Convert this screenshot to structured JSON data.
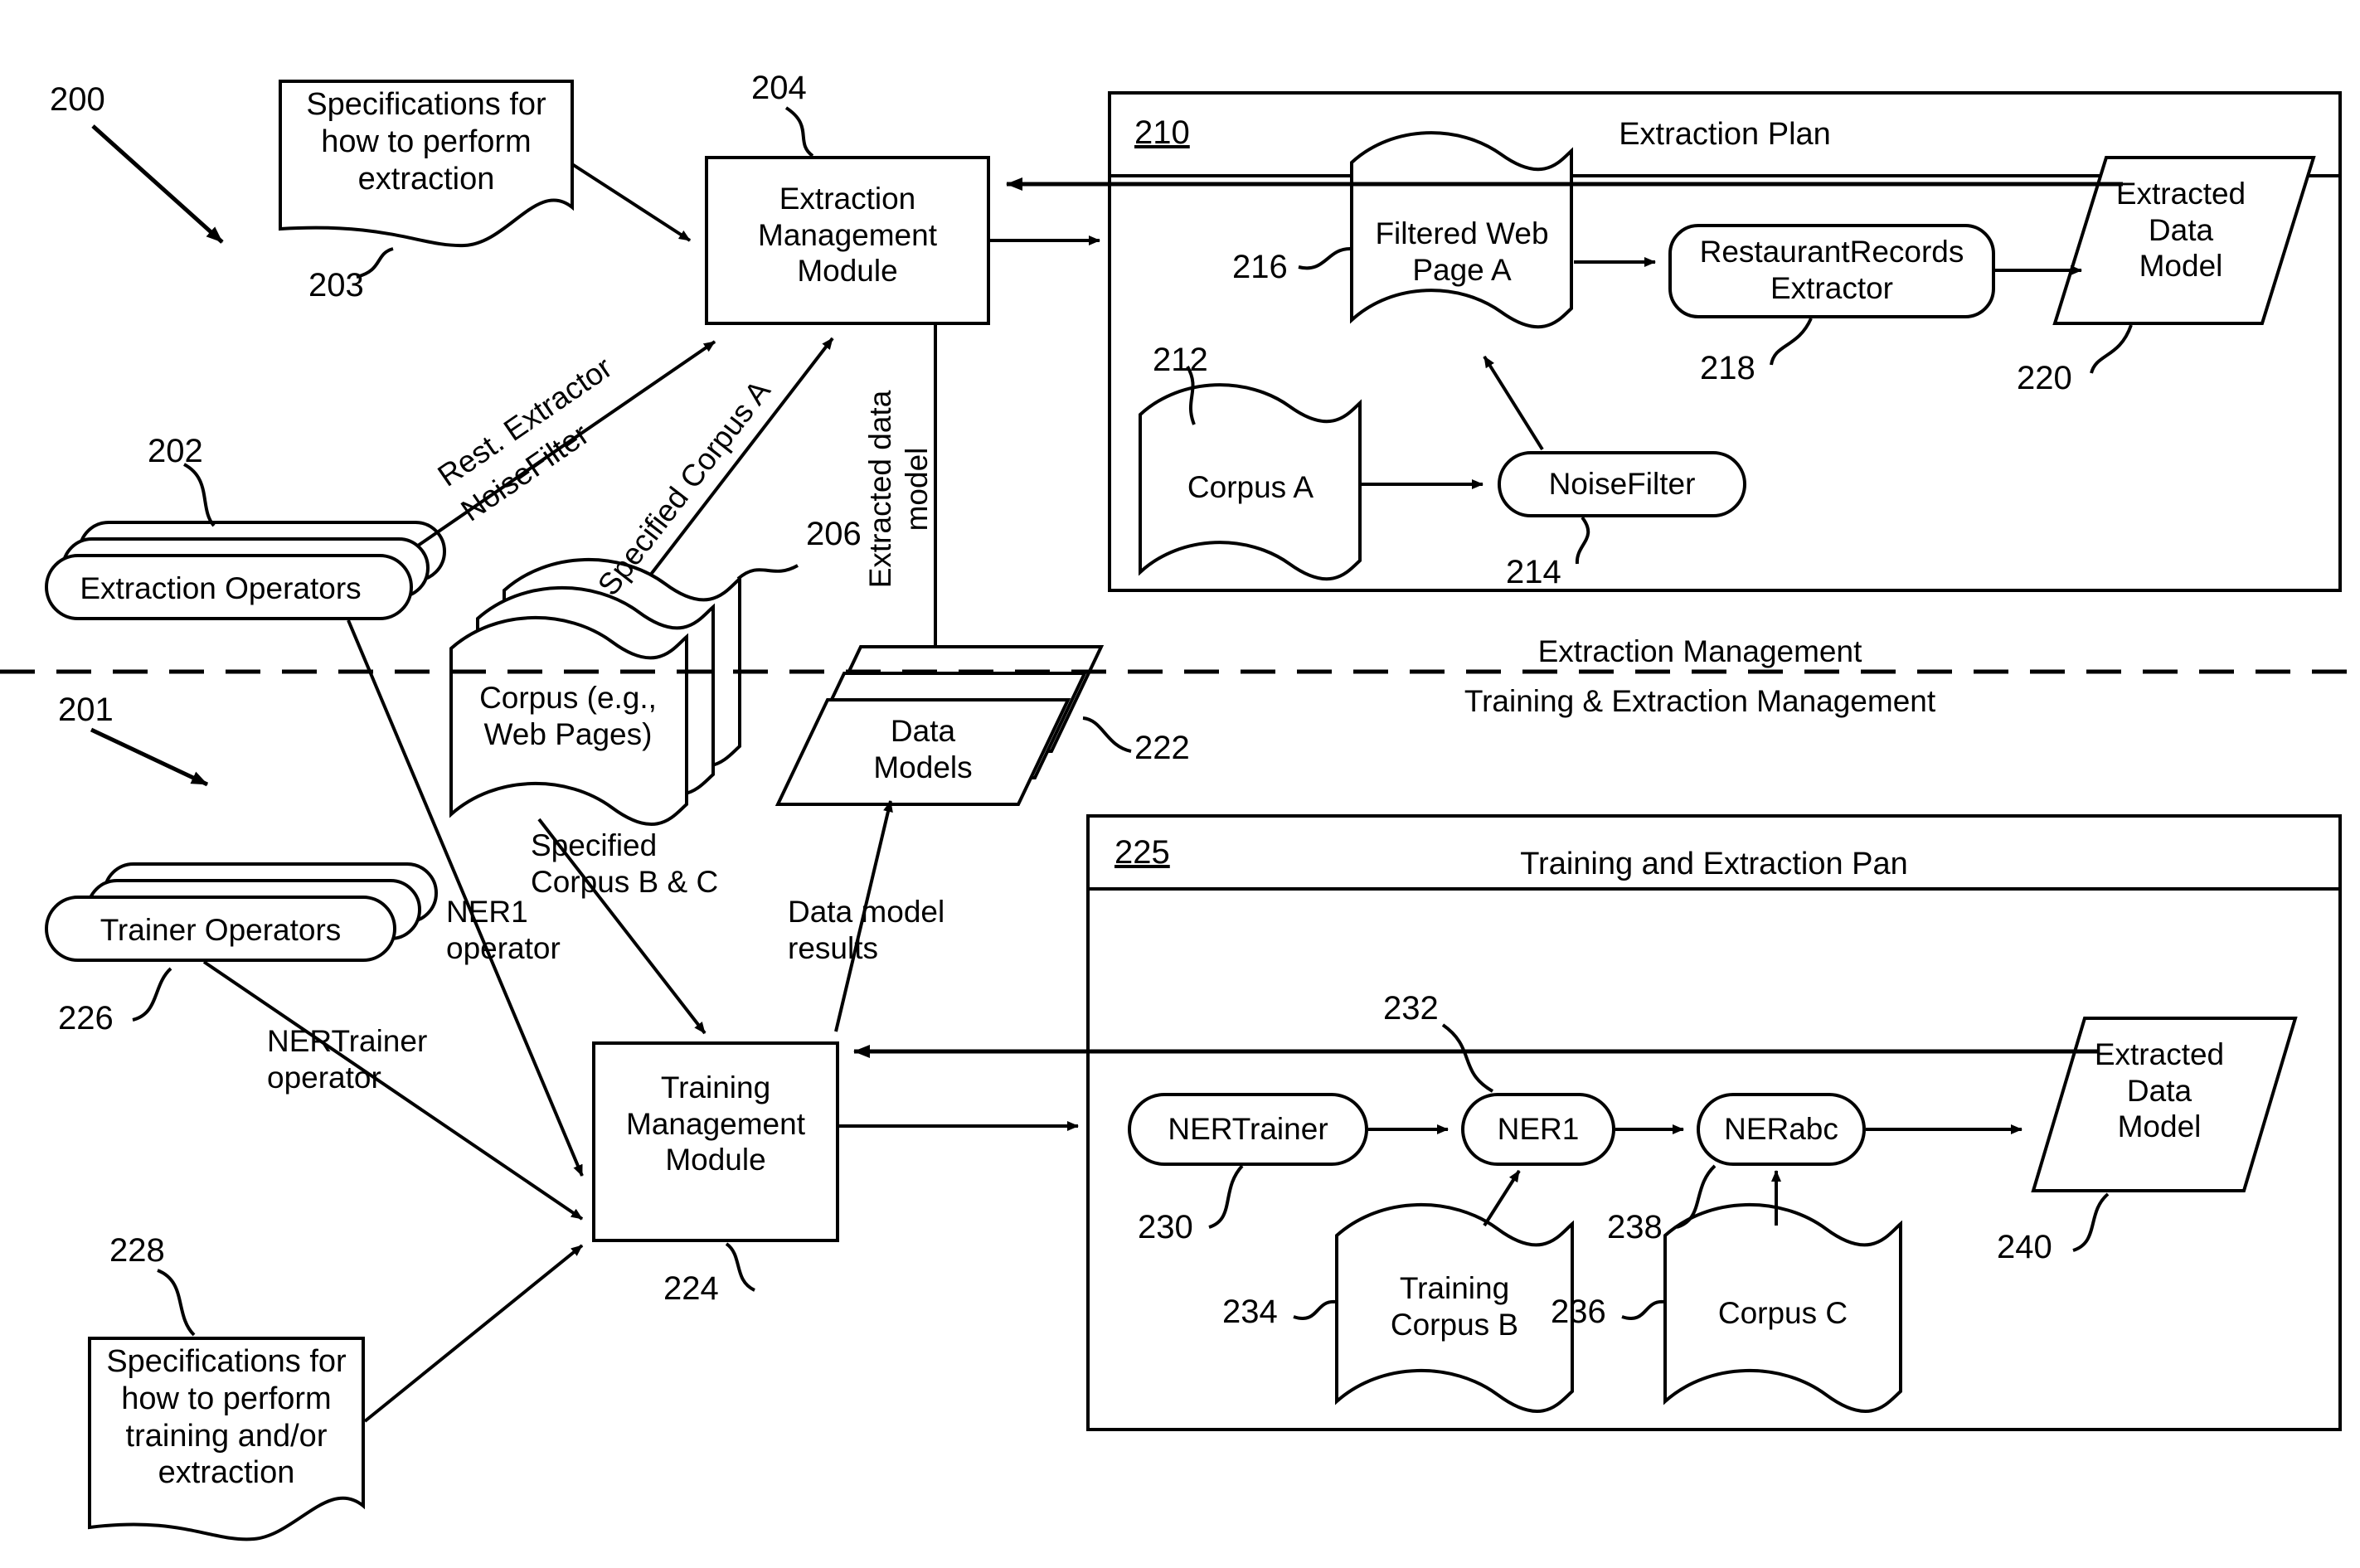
{
  "figure": {
    "ref_main_top": "200",
    "ref_main_bottom": "201"
  },
  "top_section": {
    "spec_box": {
      "ref": "203",
      "text": "Specifications for\nhow to perform\nextraction"
    },
    "extraction_management_module": {
      "ref": "204",
      "label": "Extraction\nManagement\nModule"
    },
    "extraction_operators": {
      "ref": "202",
      "label": "Extraction Operators"
    },
    "corpus_stack": {
      "ref": "206",
      "label": "Corpus (e.g.,\nWeb Pages)"
    },
    "data_models": {
      "ref": "222",
      "label": "Data\nModels"
    },
    "edge_labels": {
      "rest_extractor": "Rest. Extractor",
      "noise_filter": "NoiseFilter",
      "specified_corpus_a": "Specified Corpus A",
      "extracted_data_model_vertical": "Extracted data\nmodel"
    }
  },
  "extraction_plan": {
    "ref": "210",
    "title": "Extraction Plan",
    "nodes": [
      {
        "ref": "216",
        "label": "Filtered Web\nPage A",
        "shape": "document"
      },
      {
        "ref": "212",
        "label": "Corpus A",
        "shape": "document"
      },
      {
        "ref": "214",
        "label": "NoiseFilter",
        "shape": "rounded"
      },
      {
        "ref": "218",
        "label": "RestaurantRecords\nExtractor",
        "shape": "rounded"
      },
      {
        "ref": "220",
        "label": "Extracted\nData\nModel",
        "shape": "parallelogram"
      }
    ]
  },
  "divider": {
    "above_label": "Extraction Management",
    "below_label": "Training & Extraction Management"
  },
  "bottom_section": {
    "trainer_operators": {
      "ref": "226",
      "label": "Trainer Operators"
    },
    "spec_box": {
      "ref": "228",
      "text": "Specifications for\nhow to perform\ntraining and/or\nextraction"
    },
    "training_management_module": {
      "ref": "224",
      "label": "Training\nManagement\nModule"
    },
    "edge_labels": {
      "ner1_operator": "NER1\noperator",
      "nertrainer_operator": "NERTrainer\noperator",
      "specified_corpus_bc": "Specified\nCorpus B & C",
      "data_model_results": "Data model\nresults"
    }
  },
  "training_extraction_plan": {
    "ref": "225",
    "title": "Training and Extraction Pan",
    "nodes": [
      {
        "ref": "230",
        "label": "NERTrainer",
        "shape": "rounded"
      },
      {
        "ref": "232",
        "label": "NER1",
        "shape": "rounded"
      },
      {
        "ref": "238",
        "label": "NERabc",
        "shape": "rounded"
      },
      {
        "ref": "234",
        "label": "Training\nCorpus B",
        "shape": "document"
      },
      {
        "ref": "236",
        "label": "Corpus C",
        "shape": "document"
      },
      {
        "ref": "240",
        "label": "Extracted\nData\nModel",
        "shape": "parallelogram"
      }
    ]
  },
  "colors": {
    "ink": "#000000",
    "paper": "#ffffff"
  }
}
